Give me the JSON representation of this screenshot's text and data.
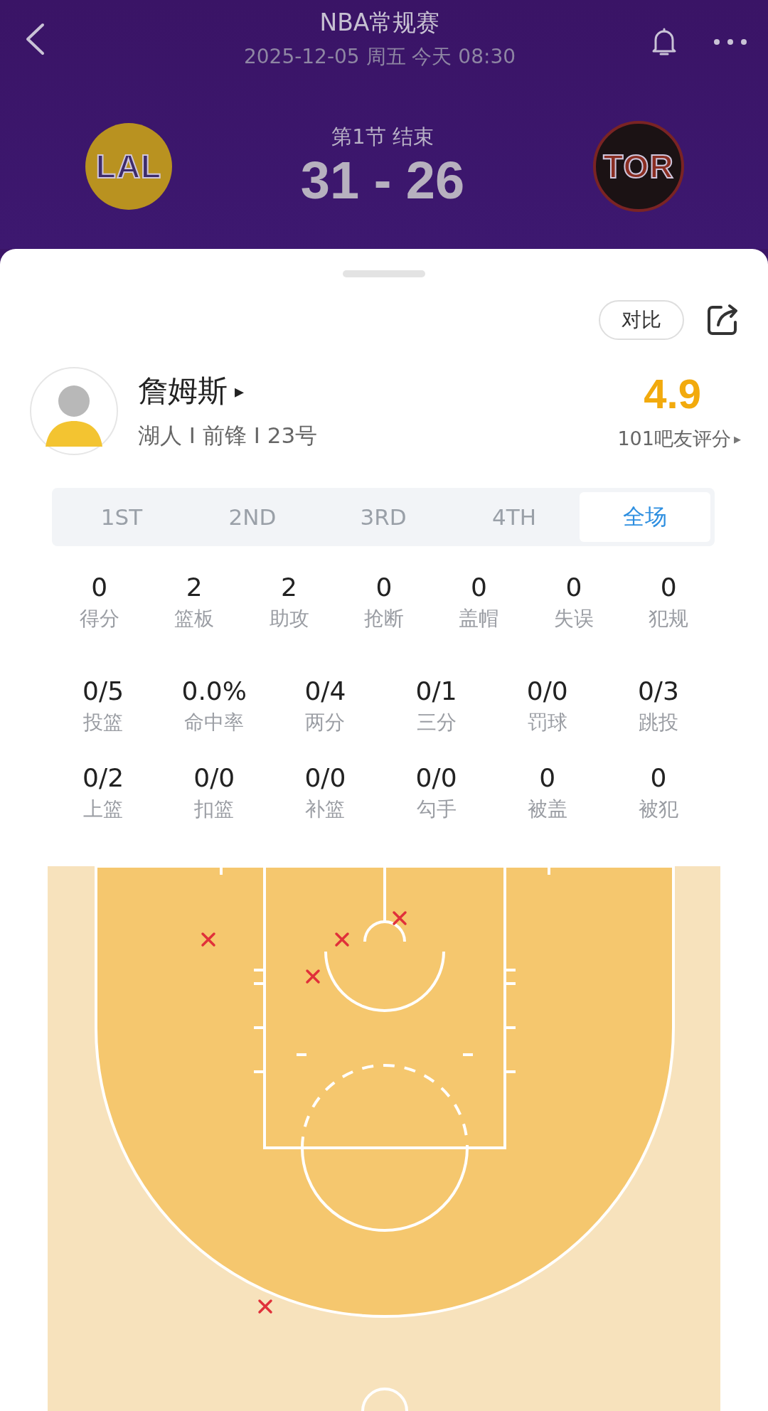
{
  "header": {
    "title": "NBA常规赛",
    "datetime": "2025-12-05 周五 今天 08:30",
    "status": "第1节 结束",
    "score": "31 - 26",
    "teams": [
      {
        "abbr": "LAL",
        "kind": "home"
      },
      {
        "abbr": "TOR",
        "kind": "away"
      }
    ]
  },
  "actions": {
    "compare": "对比"
  },
  "player": {
    "name": "詹姆斯",
    "arrow": "▸",
    "info": "湖人 I 前锋 I 23号",
    "rating": "4.9",
    "rating_label": "101吧友评分",
    "rating_arrow": "▸"
  },
  "tabs": [
    {
      "label": "1ST",
      "selected": false
    },
    {
      "label": "2ND",
      "selected": false
    },
    {
      "label": "3RD",
      "selected": false
    },
    {
      "label": "4TH",
      "selected": false
    },
    {
      "label": "全场",
      "selected": true
    }
  ],
  "stat_rows": [
    [
      {
        "value": "0",
        "label": "得分"
      },
      {
        "value": "2",
        "label": "篮板"
      },
      {
        "value": "2",
        "label": "助攻"
      },
      {
        "value": "0",
        "label": "抢断"
      },
      {
        "value": "0",
        "label": "盖帽"
      },
      {
        "value": "0",
        "label": "失误"
      },
      {
        "value": "0",
        "label": "犯规"
      }
    ],
    [
      {
        "value": "0/5",
        "label": "投篮"
      },
      {
        "value": "0.0%",
        "label": "命中率"
      },
      {
        "value": "0/4",
        "label": "两分"
      },
      {
        "value": "0/1",
        "label": "三分"
      },
      {
        "value": "0/0",
        "label": "罚球"
      },
      {
        "value": "0/3",
        "label": "跳投"
      }
    ],
    [
      {
        "value": "0/2",
        "label": "上篮"
      },
      {
        "value": "0/0",
        "label": "扣篮"
      },
      {
        "value": "0/0",
        "label": "补篮"
      },
      {
        "value": "0/0",
        "label": "勾手"
      },
      {
        "value": "0",
        "label": "被盖"
      },
      {
        "value": "0",
        "label": "被犯"
      }
    ]
  ]
}
